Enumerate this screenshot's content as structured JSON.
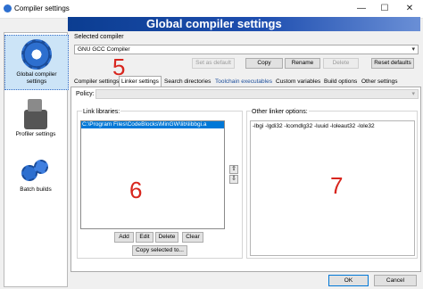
{
  "window": {
    "title": "Compiler settings",
    "minimize": "—",
    "maximize": "☐",
    "close": "✕"
  },
  "banner": {
    "title": "Global compiler settings"
  },
  "sidebar": {
    "items": [
      {
        "label_line1": "Global compiler",
        "label_line2": "settings",
        "icon": "gear-icon",
        "selected": true
      },
      {
        "label_line1": "Profiler settings",
        "icon": "profiler-icon"
      },
      {
        "label_line1": "Batch builds",
        "icon": "batch-builds-icon"
      }
    ]
  },
  "compiler": {
    "label": "Selected compiler",
    "selected": "GNU GCC Compiler",
    "buttons": {
      "set_default": "Set as default",
      "copy": "Copy",
      "rename": "Rename",
      "delete": "Delete",
      "reset": "Reset defaults"
    }
  },
  "tabs": [
    {
      "label": "Compiler settings"
    },
    {
      "label": "Linker settings",
      "active": true
    },
    {
      "label": "Search directories"
    },
    {
      "label": "Toolchain executables"
    },
    {
      "label": "Custom variables"
    },
    {
      "label": "Build options"
    },
    {
      "label": "Other settings"
    }
  ],
  "policy": {
    "label": "Policy:",
    "value": ""
  },
  "link_libraries": {
    "label": "Link libraries:",
    "items": [
      "C:\\Program Files\\CodeBlocks\\MinGW\\lib\\libbgi.a"
    ],
    "buttons": {
      "add": "Add",
      "edit": "Edit",
      "delete": "Delete",
      "clear": "Clear",
      "copy_selected": "Copy selected to..."
    }
  },
  "other_linker": {
    "label": "Other linker options:",
    "value": "-lbgi -lgdi32 -lcomdlg32 -luuid -loleaut32 -lole32"
  },
  "annotations": {
    "n5": "5",
    "n6": "6",
    "n7": "7"
  },
  "footer": {
    "ok": "OK",
    "cancel": "Cancel"
  }
}
